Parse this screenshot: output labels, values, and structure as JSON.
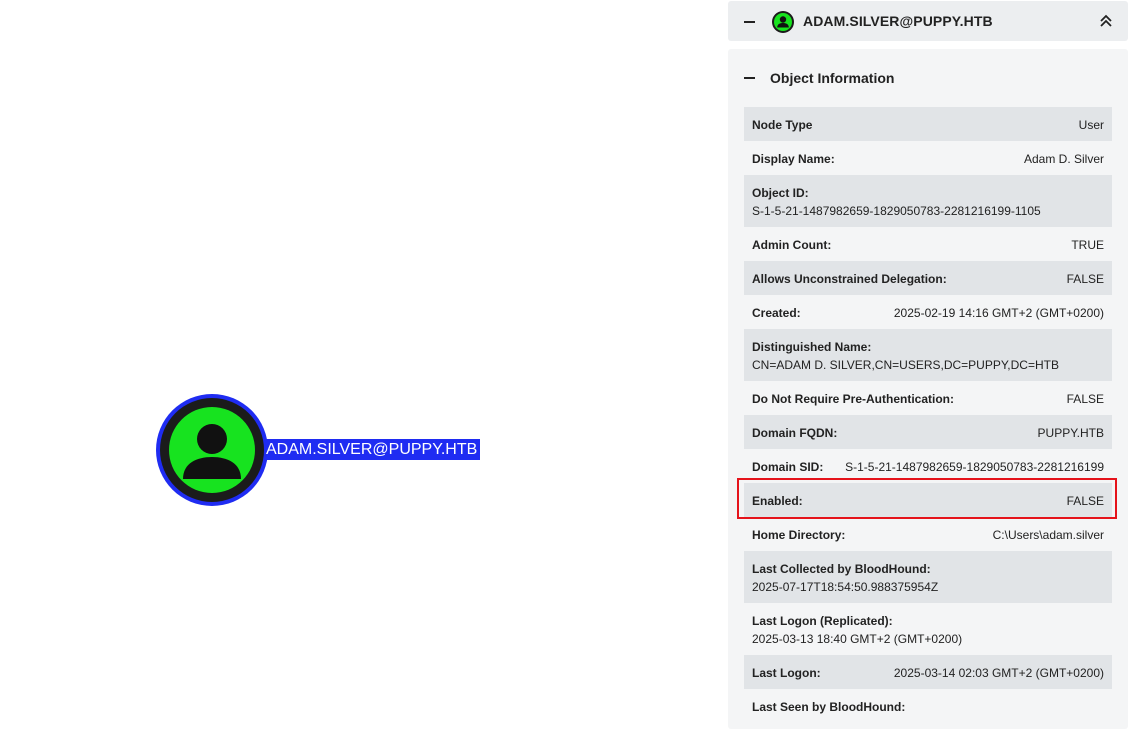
{
  "graph": {
    "node_label": "ADAM.SILVER@PUPPY.HTB",
    "node_icon": "user-icon",
    "node_color": "#17e31f",
    "selection_color": "#1f2cf2"
  },
  "panel": {
    "title": "ADAM.SILVER@PUPPY.HTB",
    "section_title": "Object Information",
    "rows": [
      {
        "key": "Node Type",
        "value": "User"
      },
      {
        "key": "Display Name:",
        "value": "Adam D. Silver"
      },
      {
        "key": "Object ID:",
        "value": "S-1-5-21-1487982659-1829050783-2281216199-1105"
      },
      {
        "key": "Admin Count:",
        "value": "TRUE"
      },
      {
        "key": "Allows Unconstrained Delegation:",
        "value": "FALSE"
      },
      {
        "key": "Created:",
        "value": "2025-02-19 14:16 GMT+2 (GMT+0200)"
      },
      {
        "key": "Distinguished Name:",
        "value": "CN=ADAM D. SILVER,CN=USERS,DC=PUPPY,DC=HTB"
      },
      {
        "key": "Do Not Require Pre-Authentication:",
        "value": "FALSE"
      },
      {
        "key": "Domain FQDN:",
        "value": "PUPPY.HTB"
      },
      {
        "key": "Domain SID:",
        "value": "S-1-5-21-1487982659-1829050783-2281216199"
      },
      {
        "key": "Enabled:",
        "value": "FALSE"
      },
      {
        "key": "Home Directory:",
        "value": "C:\\Users\\adam.silver"
      },
      {
        "key": "Last Collected by BloodHound:",
        "value": "2025-07-17T18:54:50.988375954Z"
      },
      {
        "key": "Last Logon (Replicated):",
        "value": "2025-03-13 18:40 GMT+2 (GMT+0200)"
      },
      {
        "key": "Last Logon:",
        "value": "2025-03-14 02:03 GMT+2 (GMT+0200)"
      },
      {
        "key": "Last Seen by BloodHound:",
        "value": ""
      }
    ],
    "highlight_color": "#e5131b"
  }
}
